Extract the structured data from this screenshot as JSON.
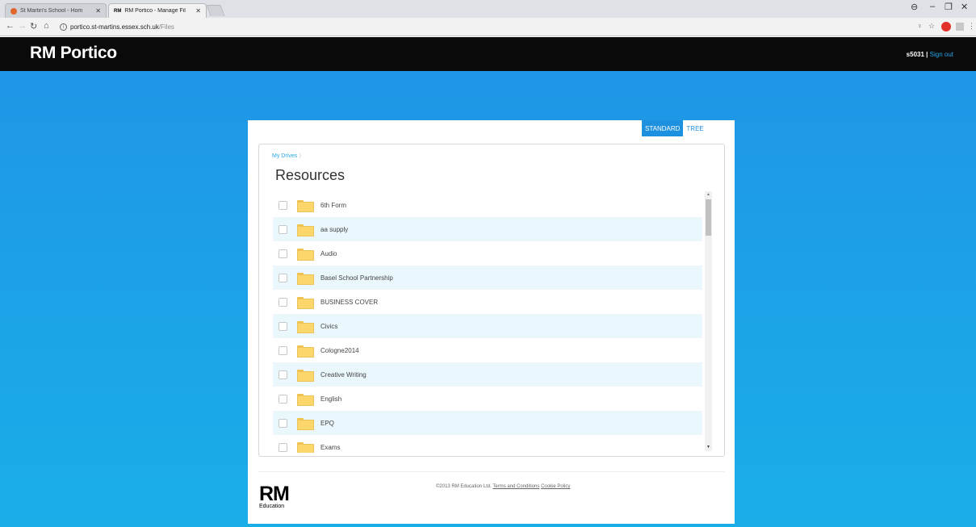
{
  "browser": {
    "tabs": [
      {
        "title": "St Martin's School - Hom",
        "active": false
      },
      {
        "title": "RM Portico - Manage Fil",
        "active": true
      }
    ],
    "url_host": "portico.st-martins.essex.sch.uk",
    "url_path": "/Files"
  },
  "header": {
    "logo": "RM Portico",
    "username": "s5031",
    "separator": "|",
    "signout": "Sign out"
  },
  "view_toggle": {
    "standard": "STANDARD",
    "tree": "TREE"
  },
  "breadcrumb": {
    "root": "My Drives",
    "chevron": "〉"
  },
  "folder": {
    "title": "Resources",
    "items": [
      "6th Form",
      "aa supply",
      "Audio",
      "Basel School Partnership",
      "BUSINESS COVER",
      "Civics",
      "Cologne2014",
      "Creative Writing",
      "English",
      "EPQ",
      "Exams"
    ]
  },
  "footer": {
    "copyright": "©2013 RM Education Ltd.",
    "terms": "Terms and Conditions",
    "cookie": "Cookie Policy",
    "brand_mark": "RM",
    "brand_tm": "™",
    "brand_name": "Education"
  },
  "colors": {
    "accent": "#1e90e0",
    "header_bg": "#0a0a0a",
    "stage_top": "#1f96e6",
    "stage_bottom": "#1aaee9",
    "row_alt": "#eaf7fc"
  }
}
